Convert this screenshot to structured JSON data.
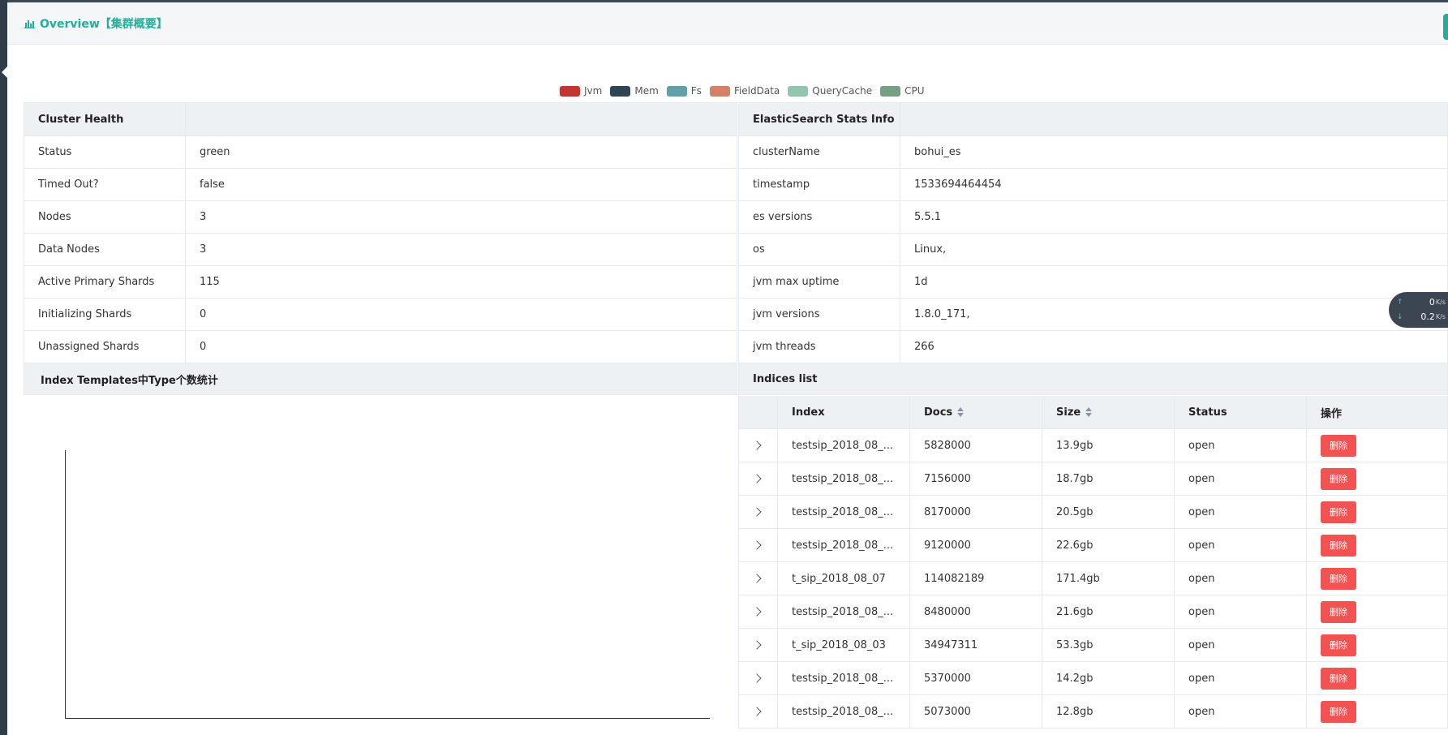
{
  "header": {
    "title": "Overview【集群概要】",
    "icon": "bar-chart-icon"
  },
  "legend": [
    {
      "label": "Jvm",
      "color": "#c23531"
    },
    {
      "label": "Mem",
      "color": "#2f4554"
    },
    {
      "label": "Fs",
      "color": "#61a0a8"
    },
    {
      "label": "FieldData",
      "color": "#d48265"
    },
    {
      "label": "QueryCache",
      "color": "#91c7ae"
    },
    {
      "label": "CPU",
      "color": "#749f83"
    }
  ],
  "health": {
    "title": "Cluster Health",
    "rows": [
      {
        "k": "Status",
        "v": "green"
      },
      {
        "k": "Timed Out?",
        "v": "false"
      },
      {
        "k": "Nodes",
        "v": "3"
      },
      {
        "k": "Data Nodes",
        "v": "3"
      },
      {
        "k": "Active Primary Shards",
        "v": "115"
      },
      {
        "k": "Initializing Shards",
        "v": "0"
      },
      {
        "k": "Unassigned Shards",
        "v": "0"
      }
    ]
  },
  "stats": {
    "title": "ElasticSearch Stats Info",
    "rows": [
      {
        "k": "clusterName",
        "v": "bohui_es"
      },
      {
        "k": "timestamp",
        "v": "1533694464454"
      },
      {
        "k": "es versions",
        "v": "5.5.1"
      },
      {
        "k": "os",
        "v": "Linux,"
      },
      {
        "k": "jvm max uptime",
        "v": "1d"
      },
      {
        "k": "jvm versions",
        "v": "1.8.0_171,"
      },
      {
        "k": "jvm threads",
        "v": "266"
      }
    ]
  },
  "templates": {
    "title": "Index Templates中Type个数统计"
  },
  "indices": {
    "title": "Indices list",
    "columns": [
      "Index",
      "Docs",
      "Size",
      "Status",
      "操作"
    ],
    "delete_label": "删除",
    "rows": [
      {
        "index": "testsip_2018_08_...",
        "docs": "5828000",
        "size": "13.9gb",
        "status": "open"
      },
      {
        "index": "testsip_2018_08_...",
        "docs": "7156000",
        "size": "18.7gb",
        "status": "open"
      },
      {
        "index": "testsip_2018_08_...",
        "docs": "8170000",
        "size": "20.5gb",
        "status": "open"
      },
      {
        "index": "testsip_2018_08_...",
        "docs": "9120000",
        "size": "22.6gb",
        "status": "open"
      },
      {
        "index": "t_sip_2018_08_07",
        "docs": "114082189",
        "size": "171.4gb",
        "status": "open"
      },
      {
        "index": "testsip_2018_08_...",
        "docs": "8480000",
        "size": "21.6gb",
        "status": "open"
      },
      {
        "index": "t_sip_2018_08_03",
        "docs": "34947311",
        "size": "53.3gb",
        "status": "open"
      },
      {
        "index": "testsip_2018_08_...",
        "docs": "5370000",
        "size": "14.2gb",
        "status": "open"
      },
      {
        "index": "testsip_2018_08_...",
        "docs": "5073000",
        "size": "12.8gb",
        "status": "open"
      }
    ]
  },
  "net": {
    "up": "0",
    "down": "0.2",
    "unit": "K/s"
  }
}
